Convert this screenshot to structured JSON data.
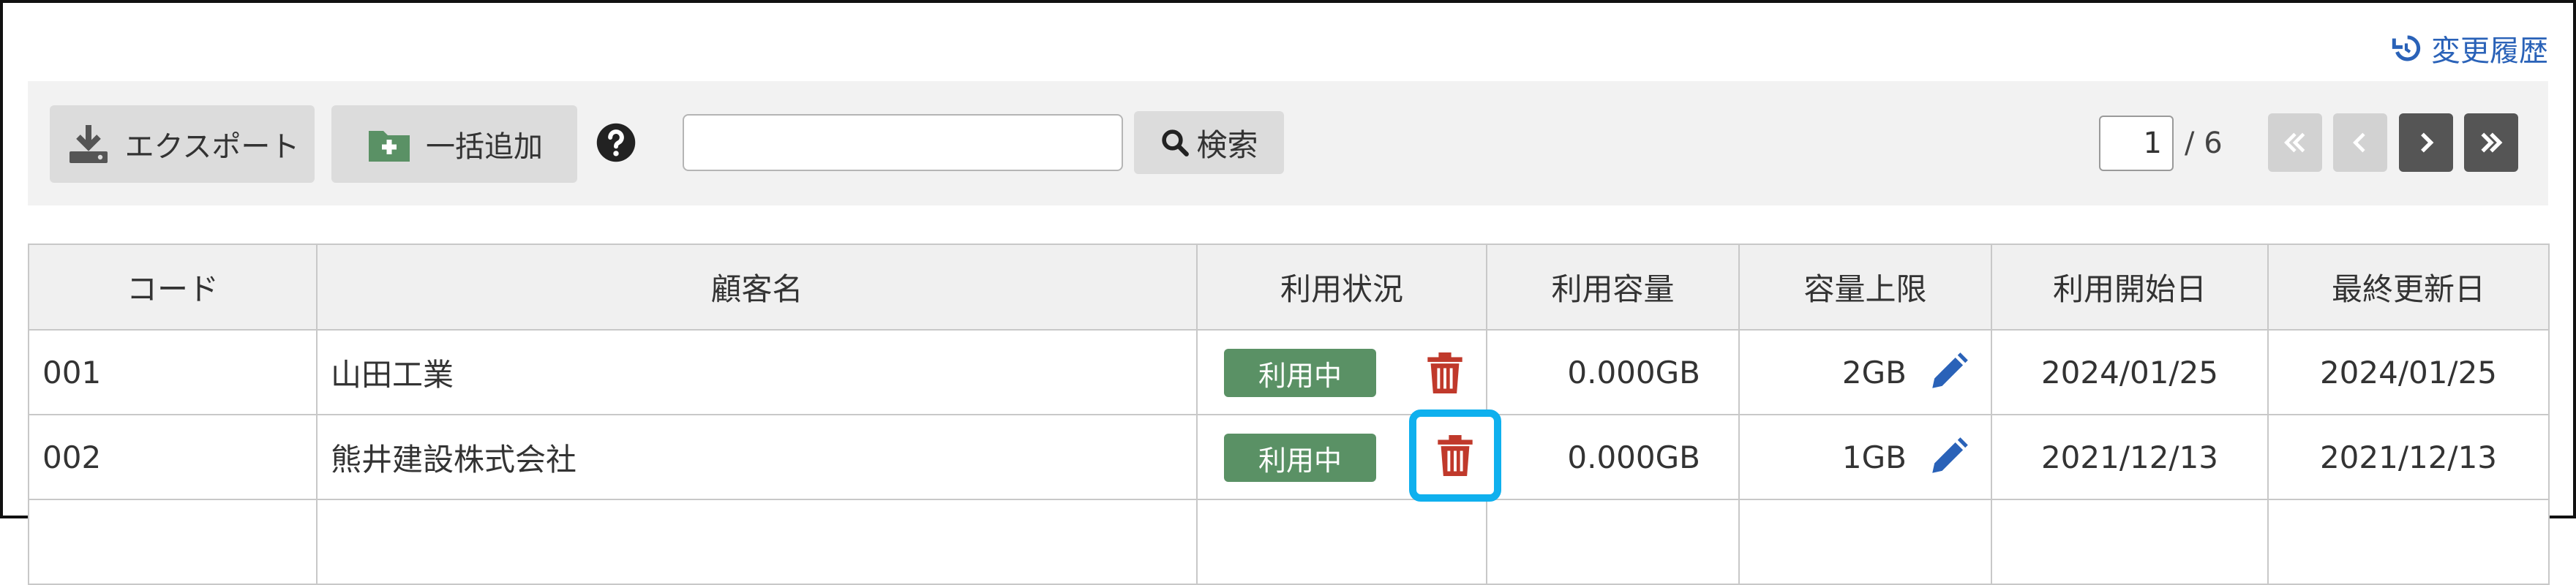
{
  "header": {
    "history_label": "変更履歴",
    "history_icon": "history-icon"
  },
  "toolbar": {
    "export_label": "エクスポート",
    "export_icon": "download-icon",
    "bulk_add_label": "一括追加",
    "bulk_add_icon": "folder-plus-icon",
    "help_icon": "question-circle-icon",
    "search_value": "",
    "search_label": "検索",
    "search_icon": "search-icon"
  },
  "pagination": {
    "current_page": "1",
    "total_text": "/ 6",
    "first_icon": "double-chevron-left-icon",
    "prev_icon": "chevron-left-icon",
    "next_icon": "chevron-right-icon",
    "last_icon": "double-chevron-right-icon"
  },
  "table": {
    "columns": [
      "コード",
      "顧客名",
      "利用状況",
      "利用容量",
      "容量上限",
      "利用開始日",
      "最終更新日"
    ],
    "rows": [
      {
        "code": "001",
        "customer": "山田工業",
        "status": "利用中",
        "usage": "0.000GB",
        "limit": "2GB",
        "start": "2024/01/25",
        "updated": "2024/01/25"
      },
      {
        "code": "002",
        "customer": "熊井建設株式会社",
        "status": "利用中",
        "usage": "0.000GB",
        "limit": "1GB",
        "start": "2021/12/13",
        "updated": "2021/12/13"
      }
    ]
  },
  "colors": {
    "accent_link": "#2a62b8",
    "status_green": "#5a9165",
    "delete_red": "#c0392b",
    "edit_blue": "#2a62b8",
    "focus_highlight": "#0fb0ee"
  }
}
